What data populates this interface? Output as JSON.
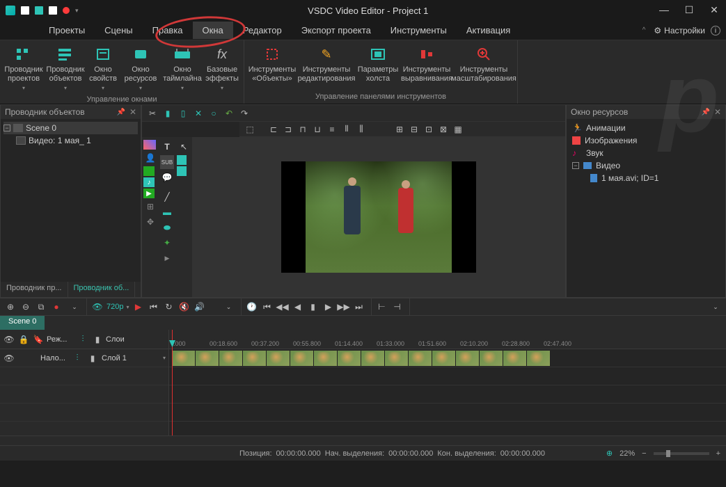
{
  "title": "VSDC Video Editor - Project 1",
  "settings_label": "Настройки",
  "menu": [
    "Проекты",
    "Сцены",
    "Правка",
    "Окна",
    "Редактор",
    "Экспорт проекта",
    "Инструменты",
    "Активация"
  ],
  "menu_active": 3,
  "ribbon": {
    "group1": {
      "title": "Управление окнами",
      "items": [
        "Проводник проектов",
        "Проводник объектов",
        "Окно свойств",
        "Окно ресурсов",
        "Окно таймлайна",
        "Базовые эффекты"
      ]
    },
    "group2": {
      "title": "Управление панелями инструментов",
      "items": [
        "Инструменты «Объекты»",
        "Инструменты редактирования",
        "Параметры холста",
        "Инструменты выравнивания",
        "Инструменты масштабирования"
      ]
    }
  },
  "left_panel": {
    "title": "Проводник объектов",
    "scene": "Scene 0",
    "video": "Видео: 1 мая_ 1",
    "tabs": [
      "Проводник пр...",
      "Проводник об..."
    ]
  },
  "right_panel": {
    "title": "Окно ресурсов",
    "items": [
      "Анимации",
      "Изображения",
      "Звук",
      "Видео"
    ],
    "file": "1 мая.avi; ID=1"
  },
  "playbar": {
    "resolution": "720p"
  },
  "timeline": {
    "tab": "Scene 0",
    "head_cols": [
      "Реж...",
      "Слои"
    ],
    "track": {
      "name": "Нало...",
      "layer": "Слой 1"
    },
    "ruler": [
      ".000",
      "00:18.600",
      "00:37.200",
      "00:55.800",
      "01:14.400",
      "01:33.000",
      "01:51.600",
      "02:10.200",
      "02:28.800",
      "02:47.400"
    ]
  },
  "status": {
    "pos_label": "Позиция:",
    "pos_val": "00:00:00.000",
    "sel_start_label": "Нач. выделения:",
    "sel_start_val": "00:00:00.000",
    "sel_end_label": "Кон. выделения:",
    "sel_end_val": "00:00:00.000",
    "zoom": "22%"
  }
}
